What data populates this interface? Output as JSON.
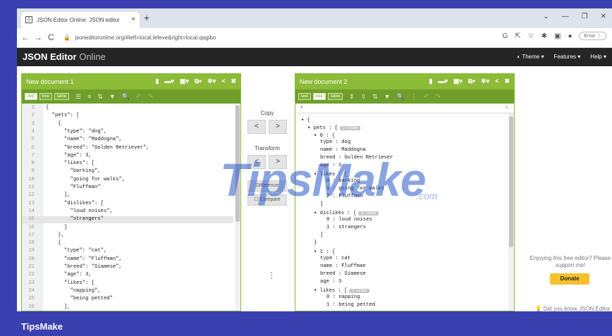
{
  "browser": {
    "tab_title": "JSON Editor Online: JSON editor",
    "tab_favicon": "{}",
    "url": "jsoneditoronline.org/#left=local.lefeve&right=local.qagibo",
    "error_label": "Error"
  },
  "app": {
    "title_bold": "JSON Editor",
    "title_light": "Online",
    "menu": [
      "Theme",
      "Features",
      "Help"
    ]
  },
  "left_panel": {
    "doc_name": "New document 1",
    "modes": [
      "text",
      "tree",
      "table"
    ],
    "lines": [
      {
        "n": "1",
        "t": "{"
      },
      {
        "n": "2",
        "t": "  \"pets\": ["
      },
      {
        "n": "3",
        "t": "    {"
      },
      {
        "n": "4",
        "t": "      \"type\": \"dog\","
      },
      {
        "n": "5",
        "t": "      \"name\": \"Maddogna\","
      },
      {
        "n": "6",
        "t": "      \"breed\": \"Golden Retriever\","
      },
      {
        "n": "7",
        "t": "      \"age\": 3,"
      },
      {
        "n": "8",
        "t": "      \"likes\": ["
      },
      {
        "n": "9",
        "t": "        \"barking\","
      },
      {
        "n": "10",
        "t": "        \"going for walks\","
      },
      {
        "n": "11",
        "t": "        \"Fluffman\""
      },
      {
        "n": "12",
        "t": "      ],"
      },
      {
        "n": "13",
        "t": "      \"dislikes\": ["
      },
      {
        "n": "14",
        "t": "        \"loud noises\","
      },
      {
        "n": "15",
        "t": "        \"strangers\""
      },
      {
        "n": "16",
        "t": "      ]"
      },
      {
        "n": "17",
        "t": "    },"
      },
      {
        "n": "18",
        "t": "    {"
      },
      {
        "n": "19",
        "t": "      \"type\": \"cat\","
      },
      {
        "n": "20",
        "t": "      \"name\": \"Fluffman\","
      },
      {
        "n": "21",
        "t": "      \"breed\": \"Siamese\","
      },
      {
        "n": "22",
        "t": "      \"age\": 3,"
      },
      {
        "n": "23",
        "t": "      \"likes\": ["
      },
      {
        "n": "24",
        "t": "        \"napping\","
      },
      {
        "n": "25",
        "t": "        \"being petted\""
      },
      {
        "n": "26",
        "t": "      ],"
      }
    ]
  },
  "middle": {
    "copy_label": "Copy",
    "transform_label": "Transform",
    "difference_label": "Difference",
    "compare_label": "Compare"
  },
  "right_panel": {
    "doc_name": "New document 2",
    "modes": [
      "text",
      "tree",
      "table"
    ],
    "tree_lines": [
      {
        "d": 0,
        "t": "▾ {"
      },
      {
        "d": 1,
        "t": "▾ pets : [",
        "badge": "2 items"
      },
      {
        "d": 2,
        "t": "▾ 0 : {"
      },
      {
        "d": 3,
        "t": "type : dog"
      },
      {
        "d": 3,
        "t": "name : Maddogna"
      },
      {
        "d": 3,
        "t": "breed : Golden Retriever"
      },
      {
        "d": 3,
        "t": "age : 3"
      },
      {
        "d": 2,
        "t": "▾ likes : ["
      },
      {
        "d": 4,
        "t": "0 : barking"
      },
      {
        "d": 4,
        "t": "1 : going for walks"
      },
      {
        "d": 4,
        "t": "2 : Fluffman"
      },
      {
        "d": 3,
        "t": "]"
      },
      {
        "d": 2,
        "t": "▾ dislikes : [",
        "badge": "2 items"
      },
      {
        "d": 4,
        "t": "0 : loud noises"
      },
      {
        "d": 4,
        "t": "1 : strangers"
      },
      {
        "d": 3,
        "t": "]"
      },
      {
        "d": 2,
        "t": "}"
      },
      {
        "d": 2,
        "t": "▾ 1 : {"
      },
      {
        "d": 3,
        "t": "type : cat"
      },
      {
        "d": 3,
        "t": "name : Fluffman"
      },
      {
        "d": 3,
        "t": "breed : Siamese"
      },
      {
        "d": 3,
        "t": "age : 3"
      },
      {
        "d": 2,
        "t": "▾ likes : [",
        "badge": "2 items"
      },
      {
        "d": 4,
        "t": "0 : napping"
      },
      {
        "d": 4,
        "t": "1 : being petted"
      }
    ]
  },
  "ad": {
    "text": "Enjoying this free editor? Please support me!",
    "donate_label": "Donate",
    "didyou": "Did you know JSON Editor Online now has a"
  },
  "watermark": {
    "main": "TipsMake",
    "suffix": ".com"
  },
  "footer_brand": "TipsMake",
  "colors": {
    "frame": "#3a3fb0",
    "accent_green": "#8bbb37",
    "donate": "#f6c12d"
  }
}
